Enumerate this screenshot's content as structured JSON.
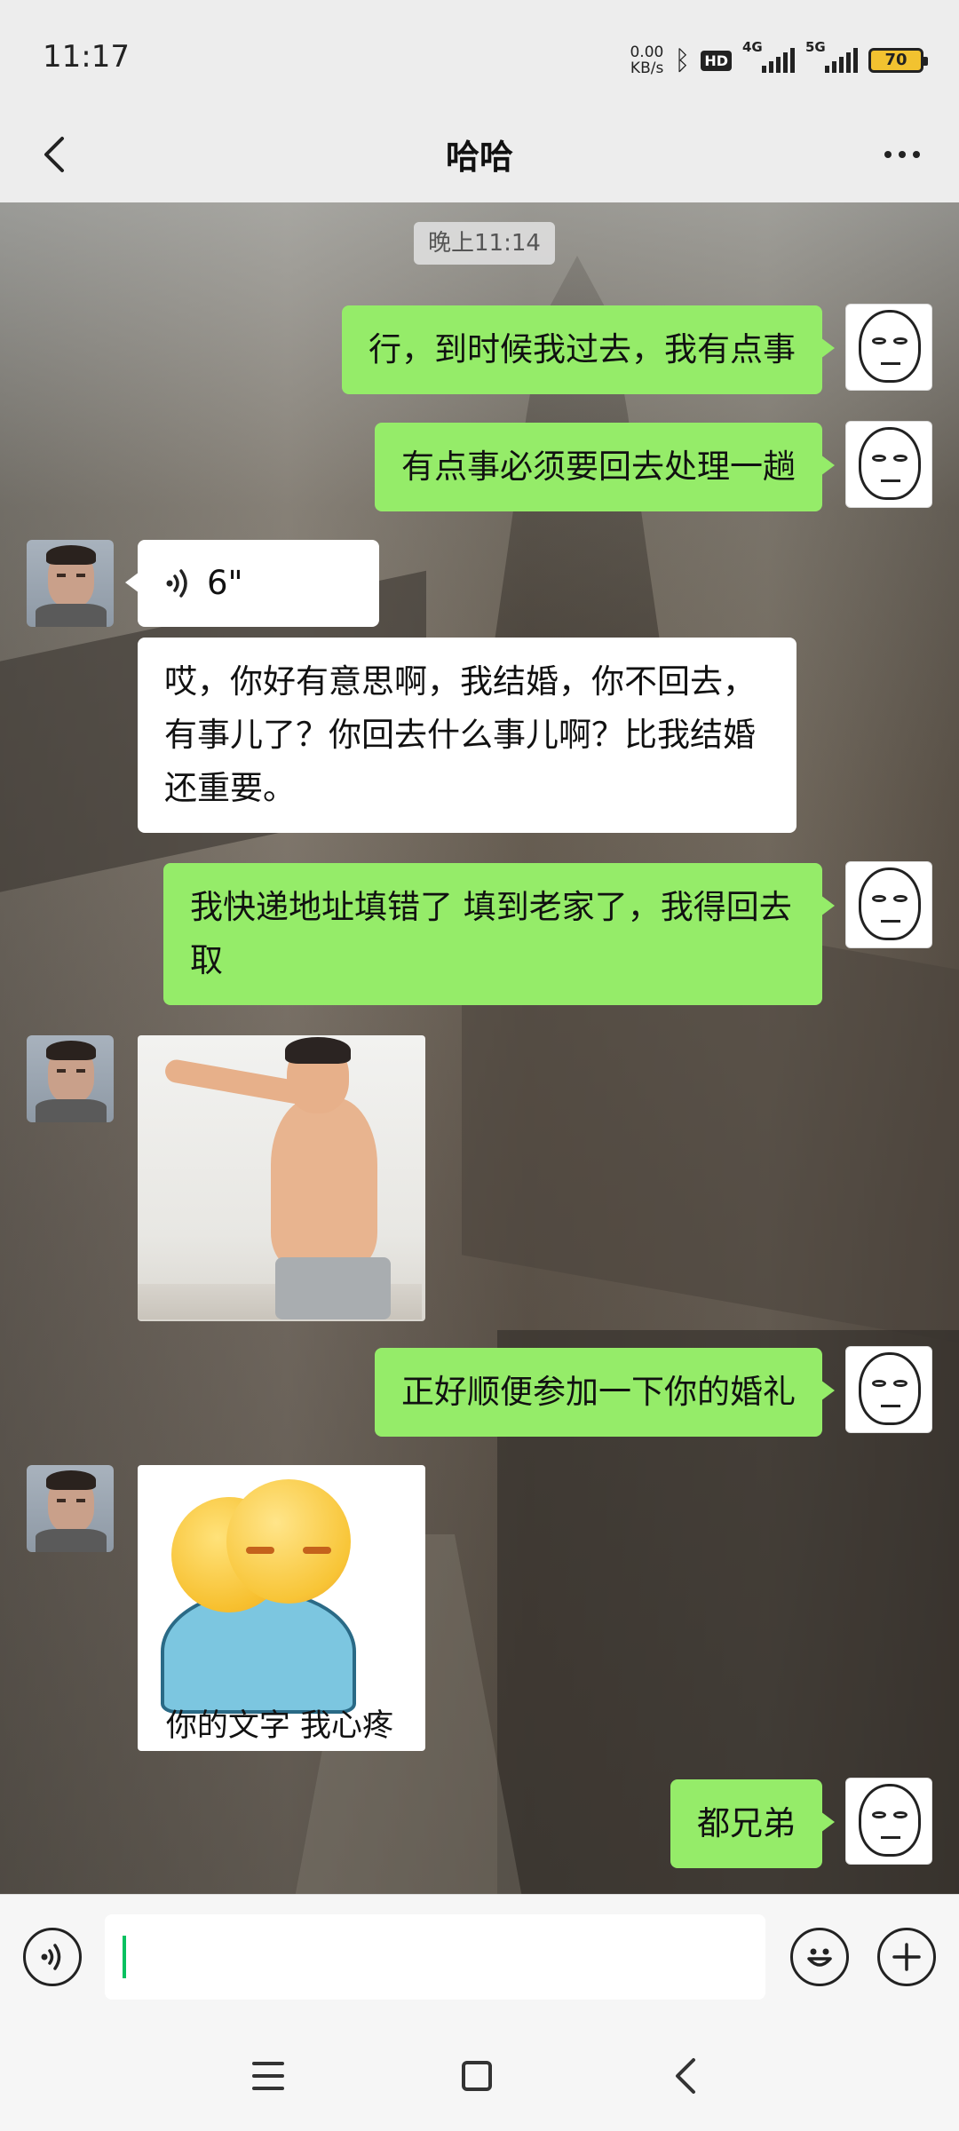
{
  "status_bar": {
    "time": "11:17",
    "net_speed_value": "0.00",
    "net_speed_unit": "KB/s",
    "hd_label": "HD",
    "signal1_label": "4G",
    "signal2_label": "5G",
    "battery": "70"
  },
  "header": {
    "title": "哈哈"
  },
  "chat": {
    "timestamp": "晚上11:14",
    "messages": [
      {
        "from": "me",
        "type": "text",
        "text": "行，到时候我过去，我有点事"
      },
      {
        "from": "me",
        "type": "text",
        "text": "有点事必须要回去处理一趟"
      },
      {
        "from": "friend",
        "type": "voice",
        "duration": "6\""
      },
      {
        "from": "friend",
        "type": "text",
        "text": "哎，你好有意思啊，我结婚，你不回去，有事儿了？你回去什么事儿啊？比我结婚还重要。"
      },
      {
        "from": "me",
        "type": "text",
        "text": "我快递地址填错了 填到老家了，我得回去取"
      },
      {
        "from": "friend",
        "type": "image",
        "image": "pointing-man-sticker"
      },
      {
        "from": "me",
        "type": "text",
        "text": "正好顺便参加一下你的婚礼"
      },
      {
        "from": "friend",
        "type": "sticker",
        "caption": "你的文字 我心疼"
      },
      {
        "from": "me",
        "type": "text",
        "text": "都兄弟"
      }
    ]
  },
  "input_bar": {
    "voice_icon": "voice-input-icon",
    "emoji_icon": "emoji-icon",
    "plus_icon": "plus-icon",
    "placeholder": ""
  },
  "colors": {
    "outgoing_bubble": "#95ec69",
    "incoming_bubble": "#ffffff",
    "cursor": "#07c160"
  }
}
